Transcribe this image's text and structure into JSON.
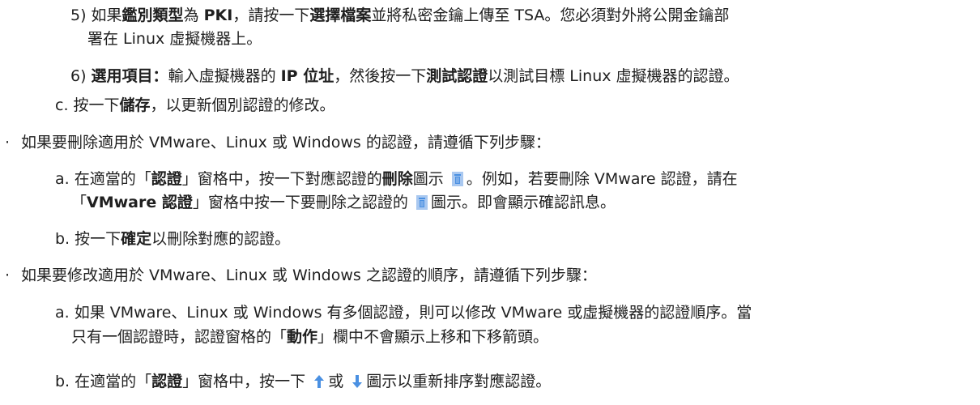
{
  "step5": {
    "prefix": "5) 如果",
    "b1": "鑑別類型",
    "t1": "為 ",
    "b2": "PKI",
    "t2": "，請按一下",
    "b3": "選擇檔案",
    "t3": "並將私密金鑰上傳至 TSA。您必須對外將公開金鑰部",
    "cont": "署在 Linux 虛擬機器上。"
  },
  "step6": {
    "prefix": "6) ",
    "b1": "選用項目：",
    "t1": "輸入虛擬機器的 ",
    "b2": "IP 位址",
    "t2": "，然後按一下",
    "b3": "測試認證",
    "t3": "以測試目標 Linux 虛擬機器的認證。"
  },
  "stepC": {
    "prefix": "c. 按一下",
    "b1": "儲存",
    "t1": "，以更新個別認證的修改。"
  },
  "bullet1": {
    "marker": "·",
    "text": "如果要刪除適用於 VMware、Linux 或 Windows 的認證，請遵循下列步驟："
  },
  "delA": {
    "prefix": "a. 在適當的「",
    "b1": "認證",
    "t1": "」窗格中，按一下對應認證的",
    "b2": "刪除",
    "t2": "圖示",
    "t3": "。例如，若要刪除 VMware 認證，請在",
    "cont_prefix": "「",
    "cont_b1": "VMware 認證",
    "cont_t1": "」窗格中按一下要刪除之認證的",
    "cont_t2": "圖示。即會顯示確認訊息。",
    "icon": "trash-icon"
  },
  "delB": {
    "prefix": "b. 按一下",
    "b1": "確定",
    "t1": "以刪除對應的認證。"
  },
  "bullet2": {
    "marker": "·",
    "text": "如果要修改適用於 VMware、Linux 或 Windows 之認證的順序，請遵循下列步驟："
  },
  "ordA": {
    "line1": "a. 如果 VMware、Linux 或 Windows 有多個認證，則可以修改 VMware 或虛擬機器的認證順序。當",
    "line2_prefix": "只有一個認證時，認證窗格的「",
    "line2_b1": "動作",
    "line2_t1": "」欄中不會顯示上移和下移箭頭。"
  },
  "ordB": {
    "prefix": "b. 在適當的「",
    "b1": "認證",
    "t1": "」窗格中，按一下",
    "t2": "或",
    "t3": "圖示以重新排序對應認證。",
    "icons": [
      "arrow-up-icon",
      "arrow-down-icon"
    ]
  },
  "colors": {
    "icon_blue": "#4a90e2",
    "icon_light": "#a9c8f0",
    "text": "#1f1f1f"
  }
}
